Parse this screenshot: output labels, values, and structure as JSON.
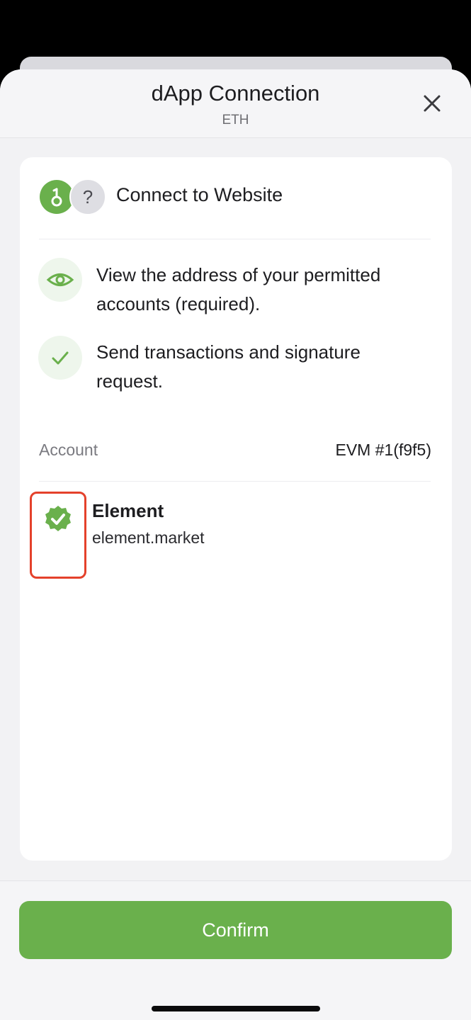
{
  "header": {
    "title": "dApp Connection",
    "subtitle": "ETH",
    "close_icon": "close-icon"
  },
  "card": {
    "section_title": "Connect to Website",
    "site_icons": [
      "site-logo-icon",
      "unknown-site-icon"
    ],
    "unknown_glyph": "?",
    "permissions": [
      {
        "icon": "eye-icon",
        "text_line1": "View the address of your permitted",
        "text_line2": "accounts (required)."
      },
      {
        "icon": "check-icon",
        "text_line1": "Send transactions and signature",
        "text_line2": "request."
      }
    ],
    "account": {
      "label": "Account",
      "value": "EVM #1(f9f5)"
    },
    "site": {
      "name": "Element",
      "url": "element.market",
      "selected": true
    }
  },
  "footer": {
    "confirm_label": "Confirm"
  },
  "colors": {
    "accent": "#6ab04c",
    "highlight": "#e4412b"
  }
}
